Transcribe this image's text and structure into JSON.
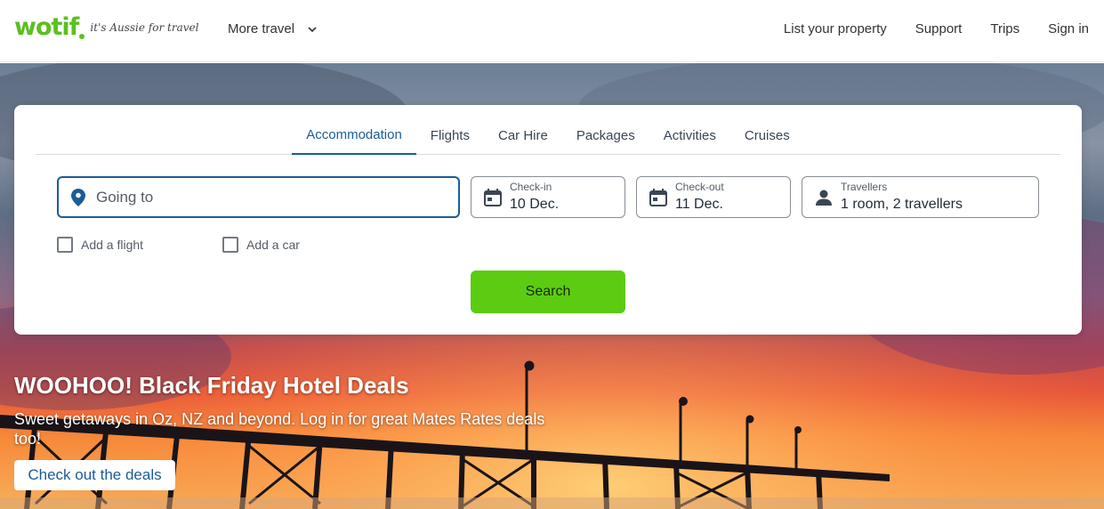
{
  "header": {
    "logo_text": "wotif",
    "logo_tagline": "it's Aussie for travel",
    "more_travel": "More travel",
    "nav": [
      "List your property",
      "Support",
      "Trips",
      "Sign in"
    ]
  },
  "search": {
    "tabs": [
      "Accommodation",
      "Flights",
      "Car Hire",
      "Packages",
      "Activities",
      "Cruises"
    ],
    "active_tab": "Accommodation",
    "going_to_placeholder": "Going to",
    "checkin_label": "Check-in",
    "checkin_value": "10 Dec.",
    "checkout_label": "Check-out",
    "checkout_value": "11 Dec.",
    "travellers_label": "Travellers",
    "travellers_value": "1 room, 2 travellers",
    "add_flight": "Add a flight",
    "add_car": "Add a car",
    "search_button": "Search"
  },
  "promo": {
    "title": "WOOHOO! Black Friday Hotel Deals",
    "subtitle": "Sweet getaways in Oz, NZ and beyond. Log in for great Mates Rates deals too!",
    "cta": "Check out the deals"
  },
  "colors": {
    "brand_green": "#5bbf21",
    "search_button": "#5bcc11",
    "accent_blue": "#1a5d98"
  },
  "icons": {
    "location": "map-pin-icon",
    "calendar": "calendar-icon",
    "person": "person-icon",
    "chevron": "chevron-down-icon"
  }
}
